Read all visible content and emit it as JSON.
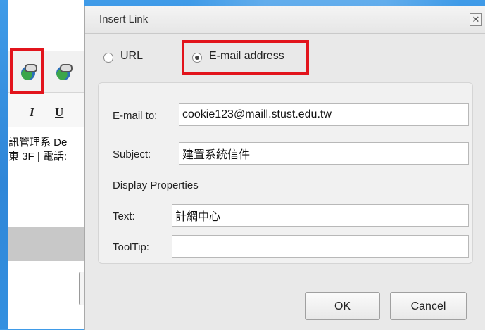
{
  "editor": {
    "toolbar": {
      "italic_label": "I",
      "underline_label": "U"
    },
    "content_lines": [
      "訊管理系 De",
      "東 3F | 電話:"
    ]
  },
  "dialog": {
    "title": "Insert Link",
    "close_label": "✕",
    "link_type": {
      "options": [
        {
          "label": "URL",
          "selected": false
        },
        {
          "label": "E-mail address",
          "selected": true
        }
      ]
    },
    "fields": {
      "email_to": {
        "label": "E-mail to:",
        "value": "cookie123@maill.stust.edu.tw"
      },
      "subject": {
        "label": "Subject:",
        "value": "建置系統信件"
      },
      "display_properties_label": "Display Properties",
      "text": {
        "label": "Text:",
        "value": "計網中心"
      },
      "tooltip": {
        "label": "ToolTip:",
        "value": ""
      }
    },
    "buttons": {
      "ok": "OK",
      "cancel": "Cancel"
    }
  },
  "colors": {
    "highlight": "#e2141c",
    "background_blue": "#2f86d8"
  }
}
